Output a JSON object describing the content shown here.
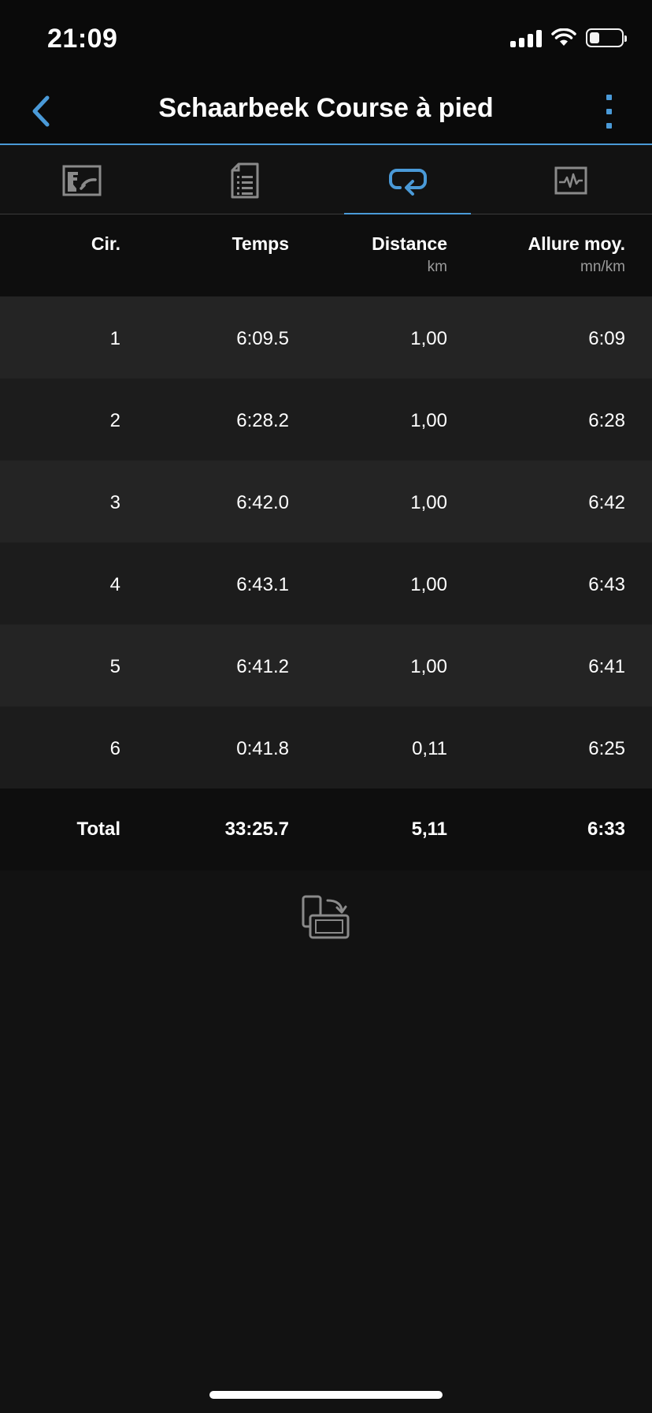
{
  "status_bar": {
    "time": "21:09"
  },
  "nav": {
    "title": "Schaarbeek Course à pied"
  },
  "tabs": [
    {
      "name": "map-chart-tab",
      "icon": "map-chart-icon",
      "active": false
    },
    {
      "name": "details-tab",
      "icon": "document-list-icon",
      "active": false
    },
    {
      "name": "laps-tab",
      "icon": "loop-arrow-icon",
      "active": true
    },
    {
      "name": "graph-tab",
      "icon": "heart-rate-chart-icon",
      "active": false
    }
  ],
  "laps_table": {
    "headers": [
      {
        "label": "Cir.",
        "unit": ""
      },
      {
        "label": "Temps",
        "unit": ""
      },
      {
        "label": "Distance",
        "unit": "km"
      },
      {
        "label": "Allure moy.",
        "unit": "mn/km"
      }
    ],
    "rows": [
      [
        "1",
        "6:09.5",
        "1,00",
        "6:09"
      ],
      [
        "2",
        "6:28.2",
        "1,00",
        "6:28"
      ],
      [
        "3",
        "6:42.0",
        "1,00",
        "6:42"
      ],
      [
        "4",
        "6:43.1",
        "1,00",
        "6:43"
      ],
      [
        "5",
        "6:41.2",
        "1,00",
        "6:41"
      ],
      [
        "6",
        "0:41.8",
        "0,11",
        "6:25"
      ]
    ],
    "total": [
      "Total",
      "33:25.7",
      "5,11",
      "6:33"
    ]
  },
  "colors": {
    "accent": "#4a9ad8",
    "background": "#121212",
    "row_alt_1": "#242424",
    "row_alt_2": "#1c1c1c",
    "icon_gray": "#8a8a8a"
  }
}
